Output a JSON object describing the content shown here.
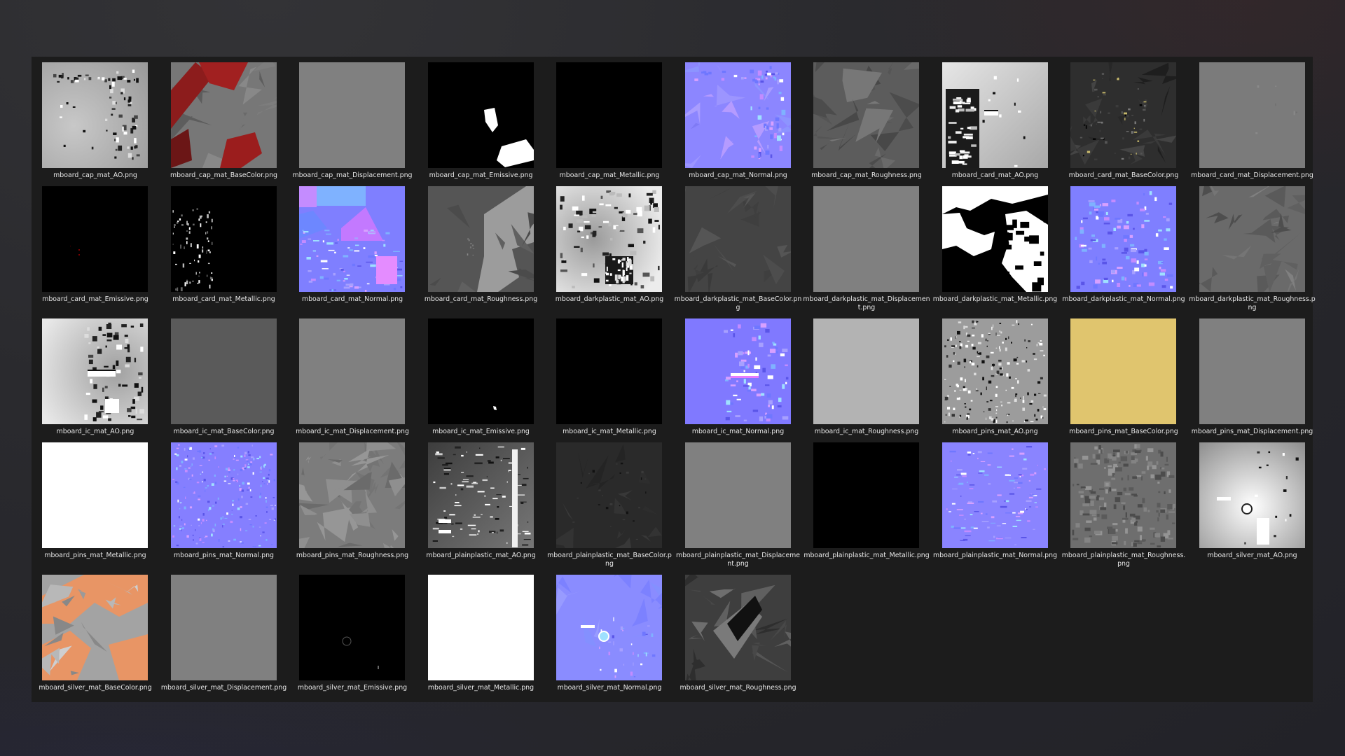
{
  "window": {
    "title": ""
  },
  "files": [
    {
      "name": "mboard_cap_mat_AO.png",
      "kind": "ao-cap"
    },
    {
      "name": "mboard_cap_mat_BaseColor.png",
      "kind": "base-cap"
    },
    {
      "name": "mboard_cap_mat_Displacement.png",
      "kind": "flat-gray"
    },
    {
      "name": "mboard_cap_mat_Emissive.png",
      "kind": "emissive-cap"
    },
    {
      "name": "mboard_cap_mat_Metallic.png",
      "kind": "flat-black"
    },
    {
      "name": "mboard_cap_mat_Normal.png",
      "kind": "normal-cap"
    },
    {
      "name": "mboard_cap_mat_Roughness.png",
      "kind": "rough-cap"
    },
    {
      "name": "mboard_card_mat_AO.png",
      "kind": "ao-card"
    },
    {
      "name": "mboard_card_mat_BaseColor.png",
      "kind": "base-card"
    },
    {
      "name": "mboard_card_mat_Displacement.png",
      "kind": "flat-midgray"
    },
    {
      "name": "mboard_card_mat_Emissive.png",
      "kind": "emissive-card"
    },
    {
      "name": "mboard_card_mat_Metallic.png",
      "kind": "metal-card"
    },
    {
      "name": "mboard_card_mat_Normal.png",
      "kind": "normal-card"
    },
    {
      "name": "mboard_card_mat_Roughness.png",
      "kind": "rough-card"
    },
    {
      "name": "mboard_darkplastic_mat_AO.png",
      "kind": "ao-dark"
    },
    {
      "name": "mboard_darkplastic_mat_BaseColor.png",
      "kind": "base-dark"
    },
    {
      "name": "mboard_darkplastic_mat_Displacement.png",
      "kind": "flat-gray"
    },
    {
      "name": "mboard_darkplastic_mat_Metallic.png",
      "kind": "metal-dark"
    },
    {
      "name": "mboard_darkplastic_mat_Normal.png",
      "kind": "normal-dark"
    },
    {
      "name": "mboard_darkplastic_mat_Roughness.png",
      "kind": "rough-dark"
    },
    {
      "name": "mboard_ic_mat_AO.png",
      "kind": "ao-ic"
    },
    {
      "name": "mboard_ic_mat_BaseColor.png",
      "kind": "flat-darkgray"
    },
    {
      "name": "mboard_ic_mat_Displacement.png",
      "kind": "flat-gray"
    },
    {
      "name": "mboard_ic_mat_Emissive.png",
      "kind": "emissive-ic"
    },
    {
      "name": "mboard_ic_mat_Metallic.png",
      "kind": "flat-black"
    },
    {
      "name": "mboard_ic_mat_Normal.png",
      "kind": "normal-ic"
    },
    {
      "name": "mboard_ic_mat_Roughness.png",
      "kind": "flat-lightgray"
    },
    {
      "name": "mboard_pins_mat_AO.png",
      "kind": "ao-pins"
    },
    {
      "name": "mboard_pins_mat_BaseColor.png",
      "kind": "flat-yellow"
    },
    {
      "name": "mboard_pins_mat_Displacement.png",
      "kind": "flat-gray"
    },
    {
      "name": "mboard_pins_mat_Metallic.png",
      "kind": "flat-white"
    },
    {
      "name": "mboard_pins_mat_Normal.png",
      "kind": "normal-pins"
    },
    {
      "name": "mboard_pins_mat_Roughness.png",
      "kind": "rough-pins"
    },
    {
      "name": "mboard_plainplastic_mat_AO.png",
      "kind": "ao-plain"
    },
    {
      "name": "mboard_plainplastic_mat_BaseColor.png",
      "kind": "base-plain"
    },
    {
      "name": "mboard_plainplastic_mat_Displacement.png",
      "kind": "flat-gray"
    },
    {
      "name": "mboard_plainplastic_mat_Metallic.png",
      "kind": "flat-black"
    },
    {
      "name": "mboard_plainplastic_mat_Normal.png",
      "kind": "normal-plain"
    },
    {
      "name": "mboard_plainplastic_mat_Roughness.png",
      "kind": "rough-plain"
    },
    {
      "name": "mboard_silver_mat_AO.png",
      "kind": "ao-silver"
    },
    {
      "name": "mboard_silver_mat_BaseColor.png",
      "kind": "base-silver"
    },
    {
      "name": "mboard_silver_mat_Displacement.png",
      "kind": "flat-gray"
    },
    {
      "name": "mboard_silver_mat_Emissive.png",
      "kind": "emissive-silver"
    },
    {
      "name": "mboard_silver_mat_Metallic.png",
      "kind": "flat-white"
    },
    {
      "name": "mboard_silver_mat_Normal.png",
      "kind": "normal-silver"
    },
    {
      "name": "mboard_silver_mat_Roughness.png",
      "kind": "rough-silver"
    }
  ],
  "colors": {
    "panel": "#1c1c1c",
    "label": "#e6e6e6",
    "normal_base": "#8080ff",
    "yellow": "#e0c56e",
    "orange": "#e89565"
  }
}
